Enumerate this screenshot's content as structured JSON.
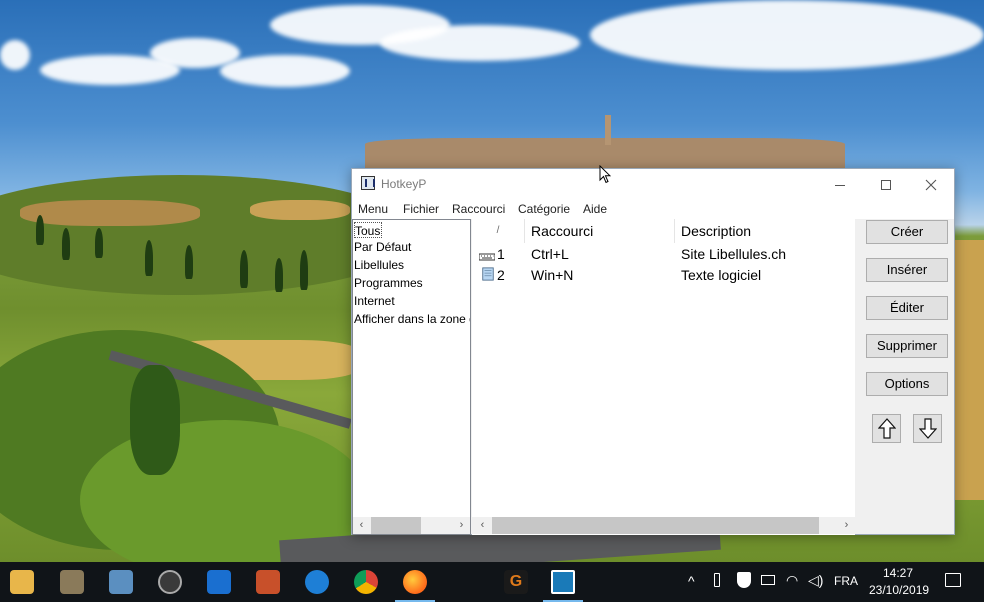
{
  "window": {
    "title": "HotkeyP",
    "menu": [
      "Menu",
      "Fichier",
      "Raccourci",
      "Catégorie",
      "Aide"
    ]
  },
  "categories": [
    "Tous",
    "Par Défaut",
    "Libellules",
    "Programmes",
    "Internet",
    "Afficher dans la zone d"
  ],
  "shortcut_table": {
    "sort_indicator": "/",
    "columns": [
      "Raccourci",
      "Description"
    ],
    "rows": [
      {
        "index": "1",
        "icon": "keyboard-icon",
        "shortcut": "Ctrl+L",
        "description": "Site Libellules.ch"
      },
      {
        "index": "2",
        "icon": "notepad-icon",
        "shortcut": "Win+N",
        "description": "Texte logiciel"
      }
    ]
  },
  "buttons": {
    "create": "Créer",
    "insert": "Insérer",
    "edit": "Éditer",
    "delete": "Supprimer",
    "options": "Options"
  },
  "taskbar": {
    "language": "FRA",
    "time": "14:27",
    "date": "23/10/2019"
  },
  "colors": {
    "taskbar": "#101418",
    "active_indicator": "#76b9ed",
    "button_face": "#e1e1e1"
  }
}
